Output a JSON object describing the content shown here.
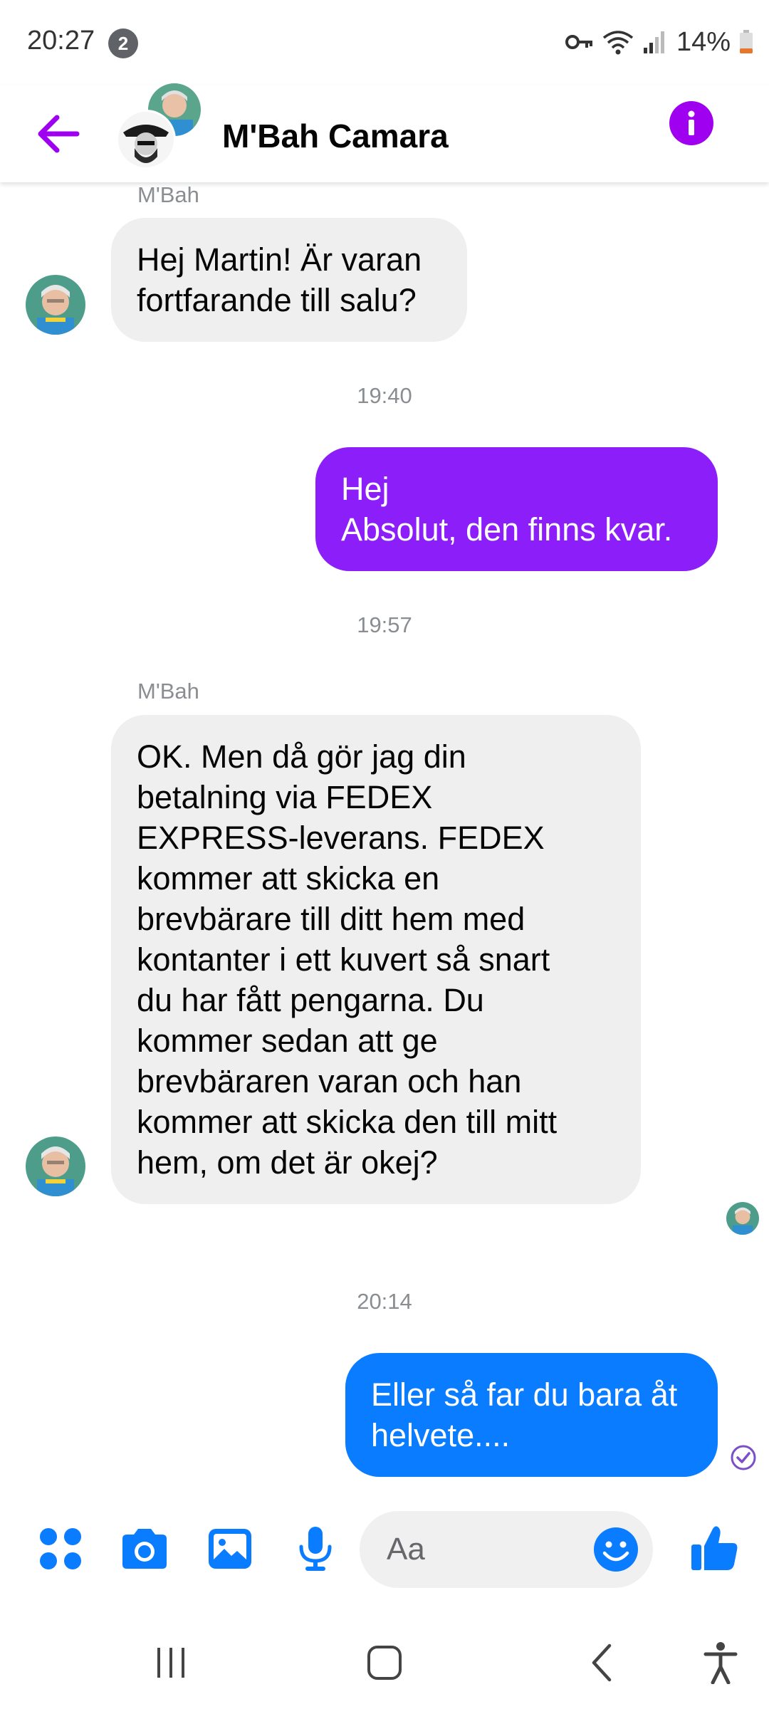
{
  "status_bar": {
    "time": "20:27",
    "notification_count": "2",
    "battery": "14%"
  },
  "header": {
    "contact_name": "M'Bah Camara",
    "accent_color": "#a000f0"
  },
  "messages": {
    "m1_sender": "M'Bah",
    "m1_text": "Hej Martin! Är varan\nfortfarande till salu?",
    "time1": "19:40",
    "m2_text": "Hej\nAbsolut, den finns kvar.",
    "time2": "19:57",
    "m3_sender": "M'Bah",
    "m3_text": "OK. Men då gör jag din\nbetalning via FEDEX\nEXPRESS-leverans. FEDEX\nkommer att skicka en\nbrevbärare till ditt hem med\nkontanter i ett kuvert så snart\ndu har fått pengarna. Du\nkommer sedan att ge\nbrevbäraren varan och han\nkommer att skicka den till mitt\nhem, om det är okej?",
    "time3": "20:14",
    "m4_text": "Eller så far du bara åt\nhelvete...."
  },
  "composer": {
    "placeholder": "Aa",
    "icons": [
      "apps-icon",
      "camera-icon",
      "gallery-icon",
      "microphone-icon",
      "emoji-icon",
      "thumbs-up-icon"
    ],
    "icon_color": "#0a7cff"
  },
  "nav": {
    "icons": [
      "recent-apps-icon",
      "home-icon",
      "back-icon",
      "accessibility-icon"
    ]
  }
}
